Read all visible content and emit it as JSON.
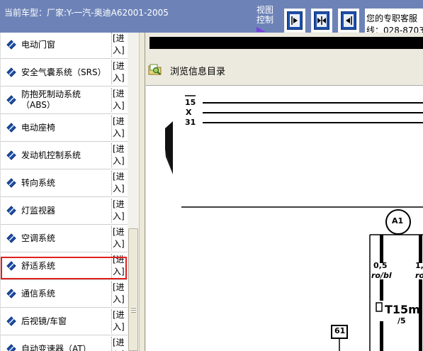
{
  "topbar": {
    "vehicle_text": "当前车型：厂家:Y-一汽-奥迪A62001-2005",
    "view_control_label": "视图控制",
    "buttons": [
      {
        "icon": "arrow-right-icon",
        "name": "view-expand-right-button"
      },
      {
        "icon": "arrows-both-icon",
        "name": "view-split-button"
      },
      {
        "icon": "arrow-left-icon",
        "name": "view-expand-left-button"
      }
    ],
    "hotline_line1": "您的专职客服",
    "hotline_line2": "线：028-8703"
  },
  "sidebar": {
    "enter_label_top": "[进",
    "enter_label_bottom": "入]",
    "items": [
      {
        "label": "电动门窗"
      },
      {
        "label": "安全气囊系统（SRS）"
      },
      {
        "label": "防抱死制动系统（ABS）"
      },
      {
        "label": "电动座椅"
      },
      {
        "label": "发动机控制系统"
      },
      {
        "label": "转向系统"
      },
      {
        "label": "灯监视器"
      },
      {
        "label": "空调系统"
      },
      {
        "label": "舒适系统",
        "selected": true
      },
      {
        "label": "通信系统"
      },
      {
        "label": "后视镜/车窗"
      },
      {
        "label": "自动变速器（AT）"
      }
    ],
    "icon": "blue-diamond-pencil-icon"
  },
  "content": {
    "browse_label": "浏览信息目录",
    "browse_icon": "folder-magnifier-icon",
    "diagram": {
      "bus_labels": [
        "15",
        "X",
        "31"
      ],
      "relay_label": "A1",
      "wire1_gauge": "0,5",
      "wire1_color": "ro/bl",
      "wire2_gauge": "1,",
      "wire2_color": "ro",
      "connector_label": "T15m",
      "connector_pin": "/5",
      "fuse_label": "61"
    }
  },
  "colors": {
    "topbar_bg": "#6d83b8",
    "selection_outline": "#e02020",
    "icon_blue": "#1d4fa8"
  }
}
